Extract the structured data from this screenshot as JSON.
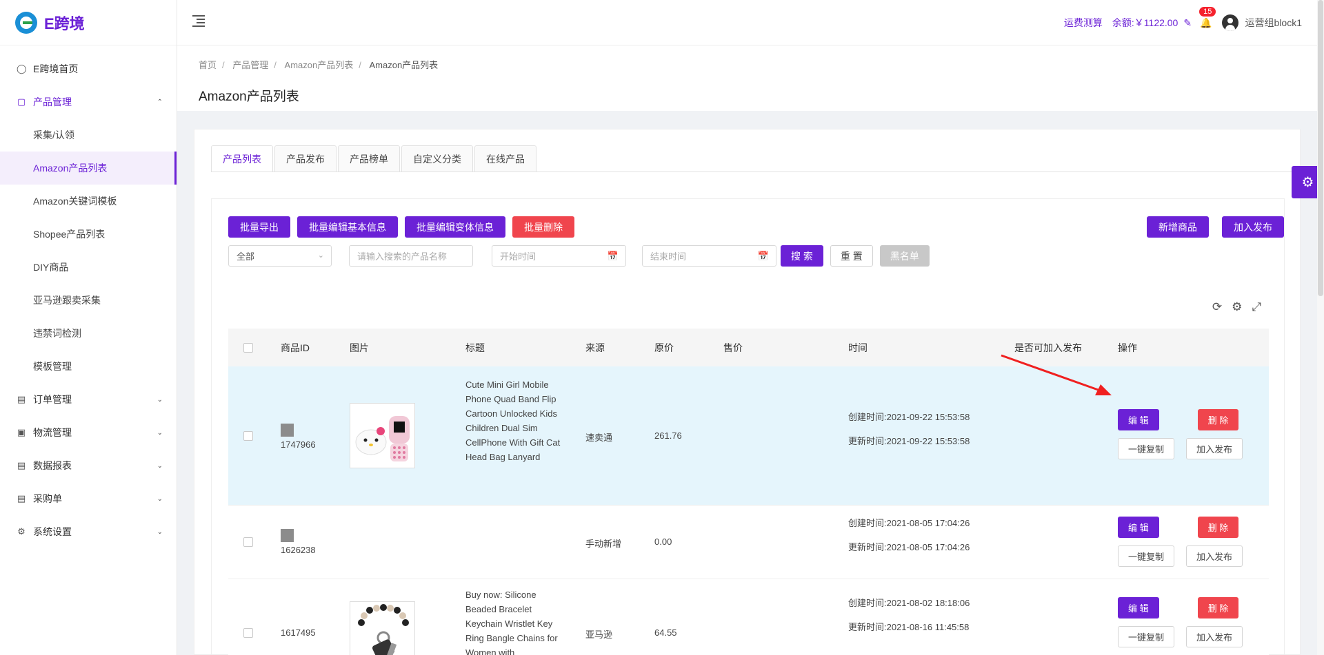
{
  "app": {
    "logo_text": "E跨境"
  },
  "sidebar": {
    "items": [
      {
        "label": "E跨境首页",
        "icon": "dashboard-icon"
      },
      {
        "label": "产品管理",
        "icon": "product-icon",
        "open": true
      },
      {
        "label": "订单管理",
        "icon": "order-icon"
      },
      {
        "label": "物流管理",
        "icon": "truck-icon"
      },
      {
        "label": "数据报表",
        "icon": "report-icon"
      },
      {
        "label": "采购单",
        "icon": "purchase-icon"
      },
      {
        "label": "系统设置",
        "icon": "gear-icon"
      }
    ],
    "sub_items": [
      {
        "label": "采集/认领"
      },
      {
        "label": "Amazon产品列表",
        "active": true
      },
      {
        "label": "Amazon关键词模板"
      },
      {
        "label": "Shopee产品列表"
      },
      {
        "label": "DIY商品"
      },
      {
        "label": "亚马逊跟卖采集"
      },
      {
        "label": "违禁词检测"
      },
      {
        "label": "模板管理"
      }
    ]
  },
  "header": {
    "cost_calc_link": "运费测算",
    "balance": "余额:￥1122.00",
    "notification_count": "15",
    "username": "运营组block1"
  },
  "breadcrumb": [
    "首页",
    "产品管理",
    "Amazon产品列表",
    "Amazon产品列表"
  ],
  "page_title": "Amazon产品列表",
  "tabs": [
    {
      "label": "产品列表",
      "active": true
    },
    {
      "label": "产品发布"
    },
    {
      "label": "产品榜单"
    },
    {
      "label": "自定义分类"
    },
    {
      "label": "在线产品"
    }
  ],
  "toolbar": {
    "batch_export": "批量导出",
    "batch_edit_basic": "批量编辑基本信息",
    "batch_edit_variant": "批量编辑变体信息",
    "batch_delete": "批量删除",
    "add_product": "新增商品",
    "add_publish": "加入发布"
  },
  "filters": {
    "status_select": "全部",
    "search_placeholder": "请输入搜索的产品名称",
    "start_time_placeholder": "开始时间",
    "end_time_placeholder": "结束时间",
    "search_button": "搜 索",
    "reset_button": "重 置",
    "blacklist_button": "黑名单"
  },
  "table": {
    "columns": [
      "商品ID",
      "图片",
      "标题",
      "来源",
      "原价",
      "售价",
      "时间",
      "是否可加入发布",
      "操作"
    ],
    "rows": [
      {
        "id": "1747966",
        "has_image": true,
        "image": "hello-kitty-phone",
        "title": "Cute Mini Girl Mobile Phone Quad Band Flip Cartoon Unlocked Kids Children Dual Sim CellPhone With Gift Cat Head Bag Lanyard",
        "source": "速卖通",
        "original_price": "261.76",
        "sale_price": "",
        "created": "创建时间:2021-09-22 15:53:58",
        "updated": "更新时间:2021-09-22 15:53:58",
        "highlighted": true
      },
      {
        "id": "1626238",
        "has_image": false,
        "title": "",
        "source": "手动新增",
        "original_price": "0.00",
        "sale_price": "",
        "created": "创建时间:2021-08-05 17:04:26",
        "updated": "更新时间:2021-08-05 17:04:26",
        "highlighted": false
      },
      {
        "id": "1617495",
        "has_image": true,
        "image": "bracelet-keychain",
        "title": "Buy now: Silicone Beaded Bracelet Keychain Wristlet Key Ring Bangle Chains for Women with",
        "source": "亚马逊",
        "original_price": "64.55",
        "sale_price": "",
        "created": "创建时间:2021-08-02 18:18:06",
        "updated": "更新时间:2021-08-16 11:45:58",
        "highlighted": false
      }
    ],
    "actions": {
      "edit": "编 辑",
      "delete": "删 除",
      "copy": "一键复制",
      "publish": "加入发布"
    }
  },
  "colors": {
    "primary": "#6b21d6",
    "danger": "#f0454d",
    "highlight_row": "#e5f5fc",
    "annotation_arrow": "#f02020"
  }
}
